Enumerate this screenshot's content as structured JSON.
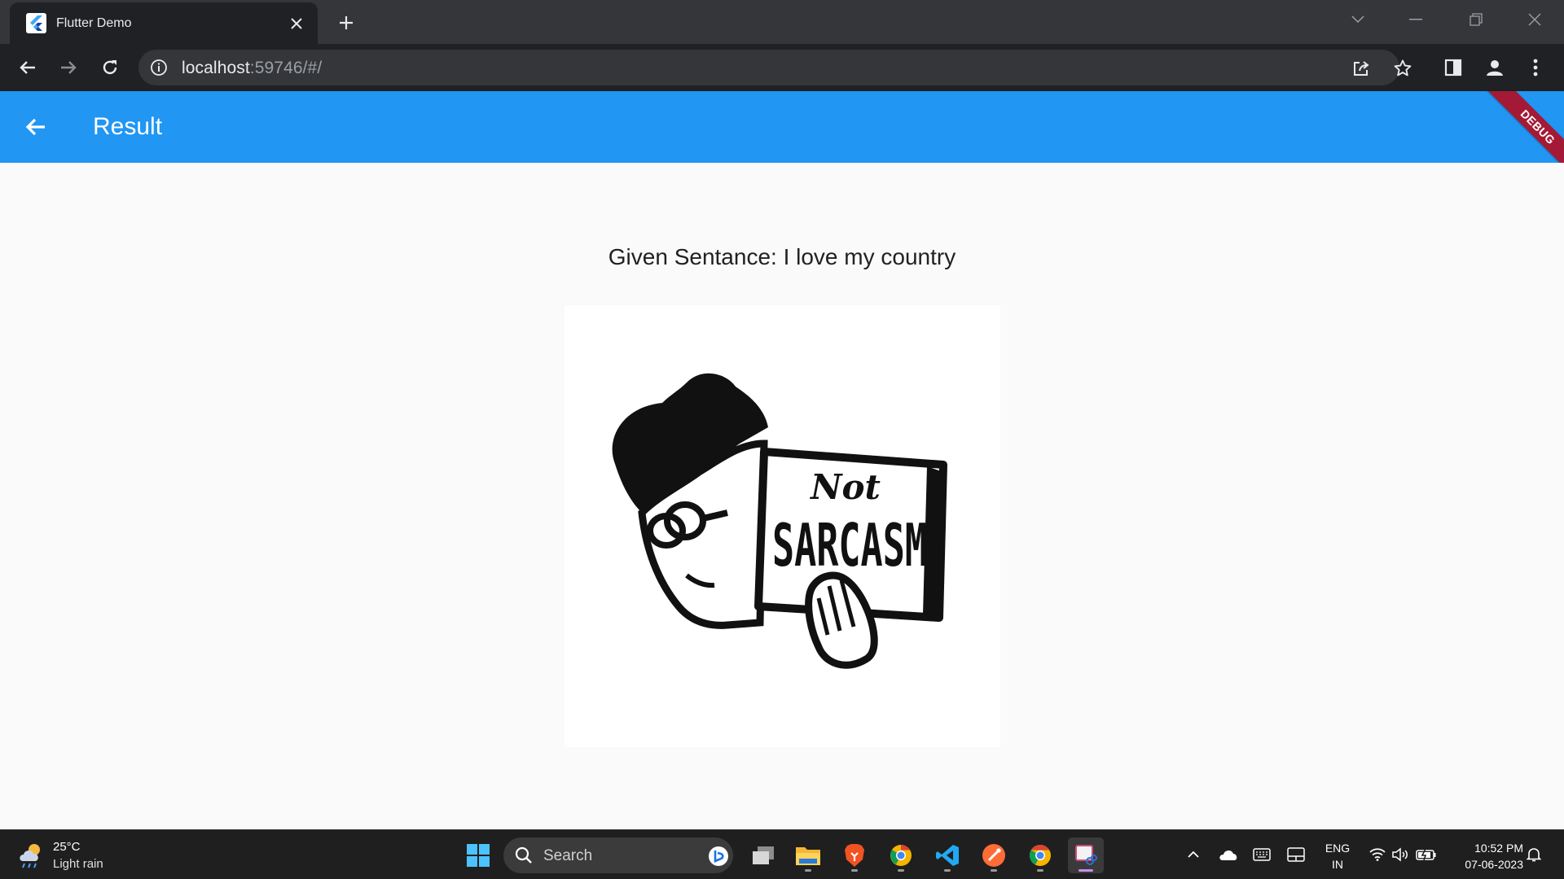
{
  "browser": {
    "tab_title": "Flutter Demo",
    "url_host": "localhost",
    "url_rest": ":59746/#/"
  },
  "app": {
    "title": "Result",
    "debug_label": "DEBUG",
    "given_sentence": "Given Sentance: I love my country",
    "result_image_text_top": "Not",
    "result_image_text_bottom": "SARCASM"
  },
  "colors": {
    "appbar": "#2196f3",
    "debug_banner": "#a41a36",
    "browser_tab": "#202124",
    "taskbar": "#1f1f1f"
  },
  "taskbar": {
    "weather_temp": "25°C",
    "weather_desc": "Light rain",
    "search_placeholder": "Search",
    "lang_top": "ENG",
    "lang_bottom": "IN",
    "time": "10:52 PM",
    "date": "07-06-2023",
    "pinned_apps": [
      "start-icon",
      "task-view-icon",
      "file-explorer-icon",
      "brave-icon",
      "chrome-canary-icon",
      "vscode-icon",
      "postman-icon",
      "chrome-icon",
      "snipping-tool-icon"
    ]
  }
}
